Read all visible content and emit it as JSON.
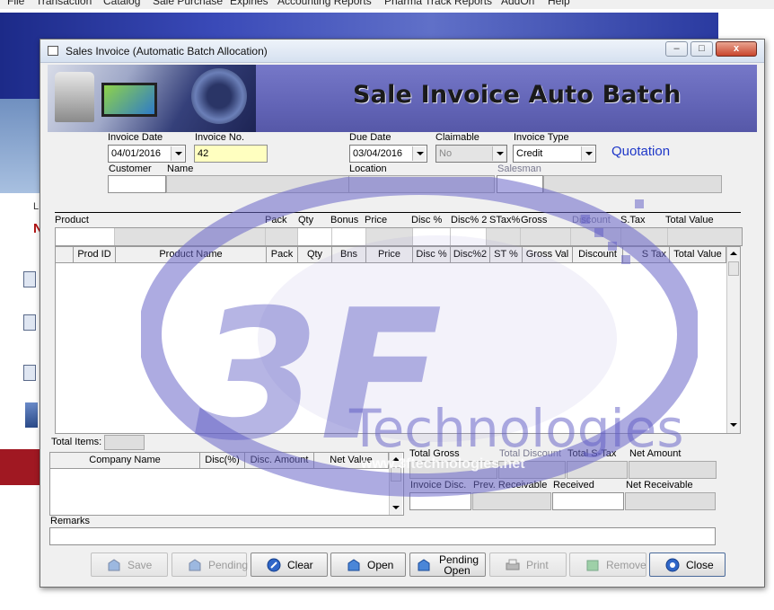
{
  "app": {
    "menu": [
      "File",
      "Transaction",
      "Catalog",
      "Sale Purchase",
      "Expiries",
      "Accounting Reports",
      "Pharma Track Reports",
      "AddOn",
      "Help"
    ],
    "side_letters": [
      "L",
      "N"
    ]
  },
  "window": {
    "title": "Sales Invoice (Automatic Batch Allocation)",
    "minimize_symbol": "–",
    "maximize_symbol": "□",
    "close_symbol": "x"
  },
  "header": {
    "title": "Sale Invoice Auto Batch"
  },
  "form": {
    "invoice_date": {
      "label": "Invoice Date",
      "value": "04/01/2016"
    },
    "invoice_no": {
      "label": "Invoice No.",
      "value": "42"
    },
    "due_date": {
      "label": "Due Date",
      "value": "03/04/2016"
    },
    "claimable": {
      "label": "Claimable",
      "value": "No"
    },
    "invoice_type": {
      "label": "Invoice Type",
      "value": "Credit"
    },
    "quotation_label": "Quotation",
    "customer": {
      "label": "Customer",
      "value": ""
    },
    "name": {
      "label": "Name",
      "value": ""
    },
    "location": {
      "label": "Location",
      "value": ""
    },
    "salesman": {
      "label": "Salesman",
      "value": ""
    }
  },
  "entry_headers": [
    "Product",
    "Pack",
    "Qty",
    "Bonus",
    "Price",
    "Disc %",
    "Disc% 2",
    "STax%",
    "Gross",
    "Discount",
    "S.Tax",
    "Total Value"
  ],
  "product_grid": {
    "columns": [
      "Prod ID",
      "Product Name",
      "Pack",
      "Qty",
      "Bns",
      "Price",
      "Disc %",
      "Disc%2",
      "ST %",
      "Gross Val",
      "Discount",
      "S Tax",
      "Total Value"
    ],
    "rows": []
  },
  "totals": {
    "total_items": {
      "label": "Total Items:",
      "value": ""
    },
    "total_gross": {
      "label": "Total Gross",
      "value": ""
    },
    "total_discount": {
      "label": "Total Discount",
      "value": ""
    },
    "total_stax": {
      "label": "Total S-Tax",
      "value": ""
    },
    "net_amount": {
      "label": "Net Amount",
      "value": ""
    },
    "invoice_disc": {
      "label": "Invoice Disc.",
      "value": ""
    },
    "prev_receivable": {
      "label": "Prev. Receivable",
      "value": ""
    },
    "received": {
      "label": "Received",
      "value": ""
    },
    "net_receivable": {
      "label": "Net Receivable",
      "value": ""
    }
  },
  "company_grid": {
    "columns": [
      "Company Name",
      "Disc(%)",
      "Disc. Amount",
      "Net Value"
    ],
    "rows": []
  },
  "remarks": {
    "label": "Remarks",
    "value": ""
  },
  "buttons": {
    "save": "Save",
    "pending": "Pending",
    "clear": "Clear",
    "open": "Open",
    "pending_open_line1": "Pending",
    "pending_open_line2": "Open",
    "print": "Print",
    "remove": "Remove",
    "close": "Close"
  },
  "watermark": {
    "logo_text": "3F",
    "brand": "Technologies",
    "url": "www.3ftechnologies.net"
  },
  "colors": {
    "header_bg": "#6466b8",
    "quotation": "#1e37c8",
    "invoice_no_bg": "#ffffc0",
    "watermark": "#6a66c8"
  }
}
